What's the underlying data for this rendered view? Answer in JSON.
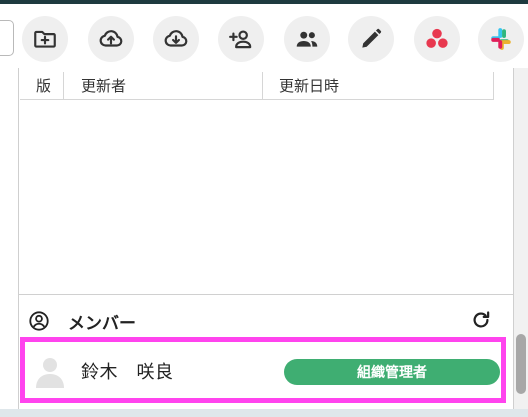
{
  "table": {
    "headers": [
      "版",
      "更新者",
      "更新日時"
    ]
  },
  "members": {
    "title": "メンバー",
    "list": [
      {
        "name": "鈴木　咲良",
        "role": "組織管理者"
      }
    ]
  },
  "toolbar": {
    "buttons": [
      "add-folder-icon",
      "upload-cloud-icon",
      "download-cloud-icon",
      "add-person-icon",
      "people-icon",
      "edit-pencil-icon",
      "asana-logo-icon",
      "slack-logo-icon"
    ]
  },
  "colors": {
    "highlight": "#ff44ee",
    "role_badge": "#3fae72",
    "top_bar": "#1e3a3f"
  }
}
